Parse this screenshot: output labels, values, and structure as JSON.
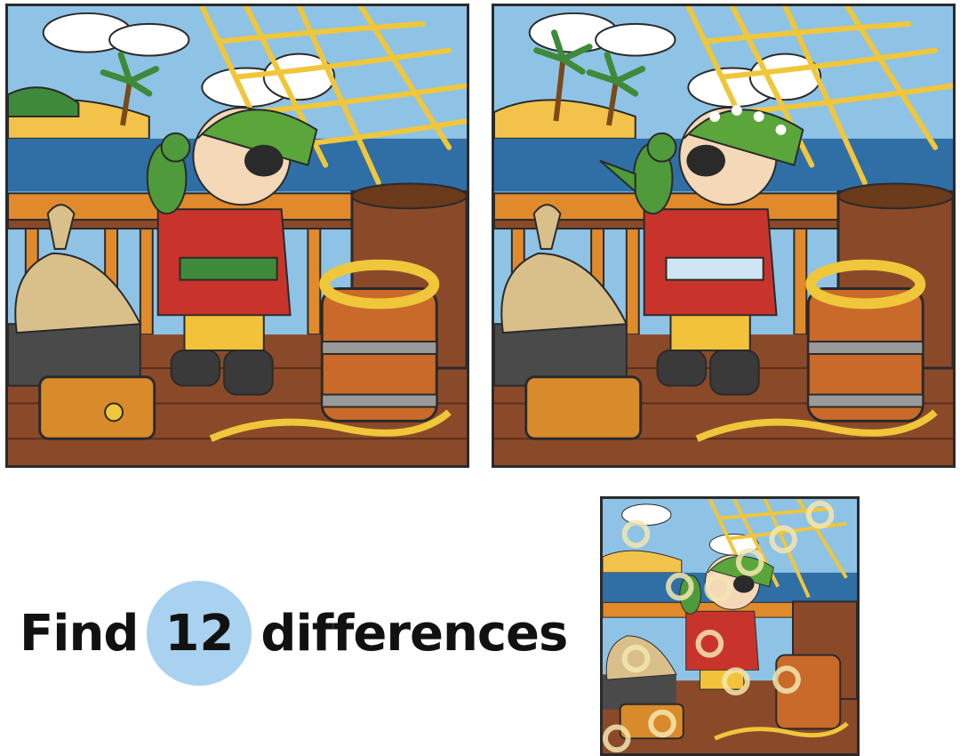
{
  "puzzle": {
    "title_prefix": "Find",
    "count": "12",
    "title_suffix": "differences"
  },
  "scene": {
    "palette": {
      "sky": "#8fc3e6",
      "sea": "#2f6fa6",
      "sand": "#f3c24a",
      "rail": "#e08a2c",
      "deck": "#8a4a2a",
      "rope": "#f0c63a",
      "bandana": "#5aa63a",
      "coat": "#c8342c",
      "pants": "#f2c23a",
      "parrot": "#4f9a3a",
      "barrel": "#c96a2a",
      "chest": "#d98a2a",
      "sack": "#d9c08a",
      "outline": "#2a2a2a"
    }
  },
  "answer_key": {
    "markers": 12
  }
}
